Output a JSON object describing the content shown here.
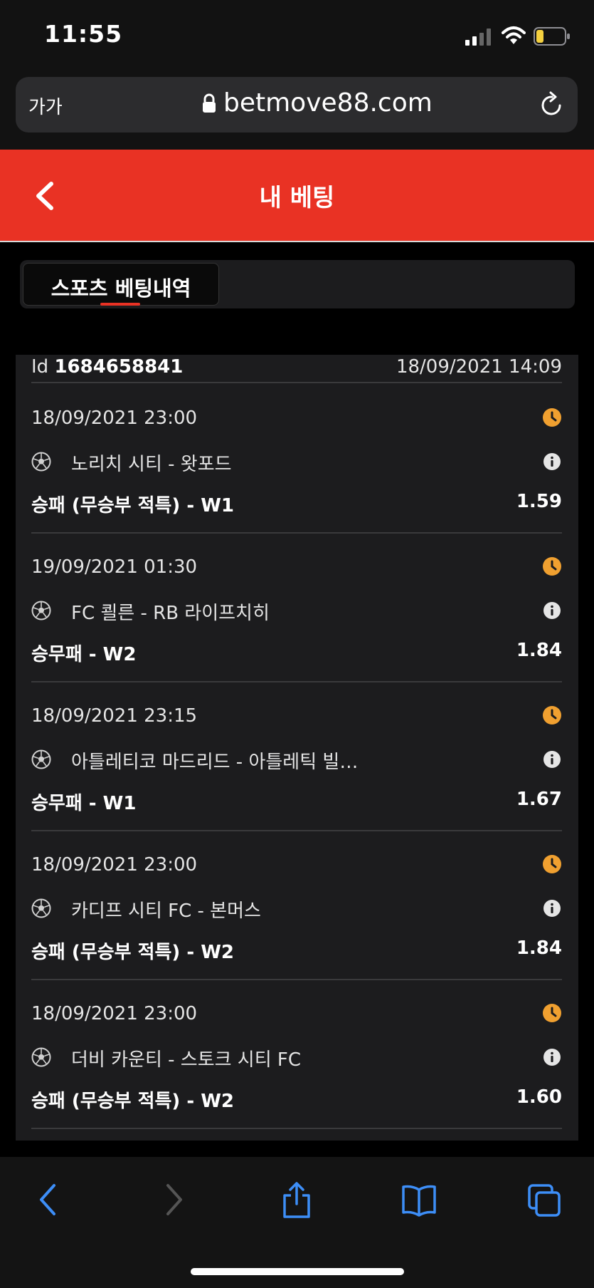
{
  "status_bar": {
    "time": "11:55"
  },
  "browser": {
    "text_size_label": "가가",
    "url": "betmove88.com"
  },
  "header": {
    "title": "내 베팅"
  },
  "tabs": [
    {
      "label": "스포츠 베팅내역",
      "active": true
    }
  ],
  "bet": {
    "id_prefix": "Id",
    "id": "1684658841",
    "placed_at": "18/09/2021 14:09",
    "selections": [
      {
        "time": "18/09/2021 23:00",
        "match": "노리치 시티 - 왓포드",
        "market": "승패 (무승부 적특) - W1",
        "odds": "1.59"
      },
      {
        "time": "19/09/2021 01:30",
        "match": "FC 쾰른 - RB 라이프치히",
        "market": "승무패 - W2",
        "odds": "1.84"
      },
      {
        "time": "18/09/2021 23:15",
        "match": "아틀레티코 마드리드 - 아틀레틱 빌…",
        "market": "승무패 - W1",
        "odds": "1.67"
      },
      {
        "time": "18/09/2021 23:00",
        "match": "카디프 시티 FC - 본머스",
        "market": "승패 (무승부 적특) - W2",
        "odds": "1.84"
      },
      {
        "time": "18/09/2021 23:00",
        "match": "더비 카운티 - 스토크 시티 FC",
        "market": "승패 (무승부 적특) - W2",
        "odds": "1.60"
      }
    ]
  },
  "colors": {
    "accent": "#e93224",
    "clock": "#f0a030",
    "ios_blue": "#3d8ef7"
  },
  "icons": [
    "signal-icon",
    "wifi-icon",
    "battery-icon",
    "lock-icon",
    "reload-icon",
    "back-chevron-icon",
    "clock-icon",
    "soccer-ball-icon",
    "info-icon",
    "back-icon",
    "forward-icon",
    "share-icon",
    "bookmarks-icon",
    "tabs-icon"
  ]
}
